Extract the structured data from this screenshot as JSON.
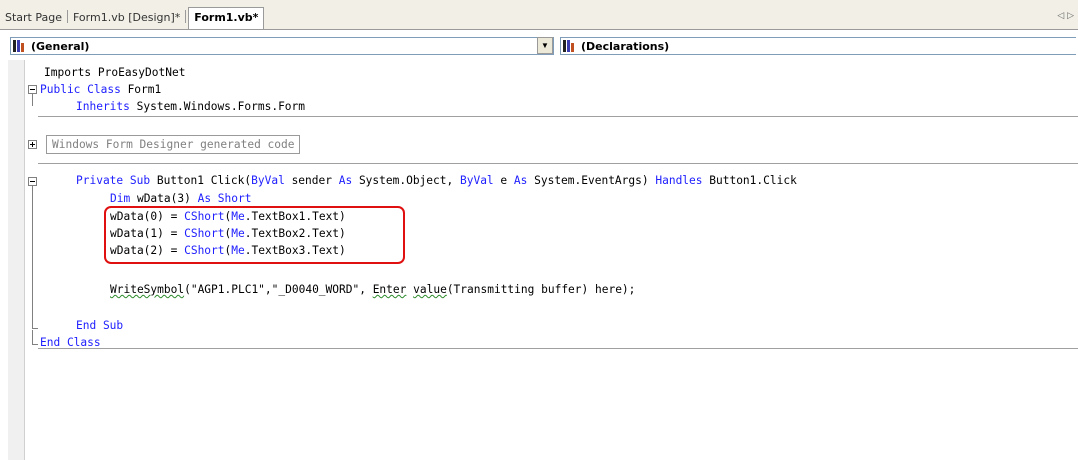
{
  "tabs": [
    {
      "label": "Start Page"
    },
    {
      "label": "Form1.vb [Design]*"
    },
    {
      "label": "Form1.vb*"
    }
  ],
  "tab_scroll_icon": "left-arrow-icon",
  "object_dropdown": {
    "selected": "(General)",
    "icon": "class-icon"
  },
  "procedure_dropdown": {
    "selected": "(Declarations)",
    "icon": "class-icon"
  },
  "colors": {
    "keyword": "#2020ff",
    "highlight_border": "#e01010",
    "squiggle": "#2a8a2a"
  },
  "code": {
    "line1": {
      "text": "Imports ProEasyDotNet"
    },
    "line2": {
      "kw": "Public Class",
      "rest": " Form1"
    },
    "line3": {
      "kw": "Inherits",
      "rest": " System.Windows.Forms.Form"
    },
    "region_label": "Windows Form Designer generated code",
    "sub_line": {
      "kw1": "Private Sub",
      "t1": " Button1 Click(",
      "kw2": "ByVal",
      "t2": " sender ",
      "kw3": "As",
      "t3": " System.Object, ",
      "kw4": "ByVal",
      "t4": " e ",
      "kw5": "As",
      "t5": " System.EventArgs) ",
      "kw6": "Handles",
      "t6": " Button1.Click"
    },
    "dim_line": {
      "kw1": "Dim",
      "t1": " wData(3) ",
      "kw2": "As Short"
    },
    "assign_lines": [
      {
        "lhs": "wData(0) = ",
        "fn": "CShort",
        "p": "(",
        "me": "Me",
        "rest": ".TextBox1.Text)"
      },
      {
        "lhs": "wData(1) = ",
        "fn": "CShort",
        "p": "(",
        "me": "Me",
        "rest": ".TextBox2.Text)"
      },
      {
        "lhs": "wData(2) = ",
        "fn": "CShort",
        "p": "(",
        "me": "Me",
        "rest": ".TextBox3.Text)"
      }
    ],
    "write_line": {
      "fn": "WriteSymbol",
      "t1": "(\"AGP1.PLC1\",\"_D0040_WORD\", ",
      "w1": "Enter",
      "t2": " ",
      "w2": "value",
      "t3": "(Transmitting buffer) here);"
    },
    "end_sub": "End Sub",
    "end_class": "End Class"
  }
}
